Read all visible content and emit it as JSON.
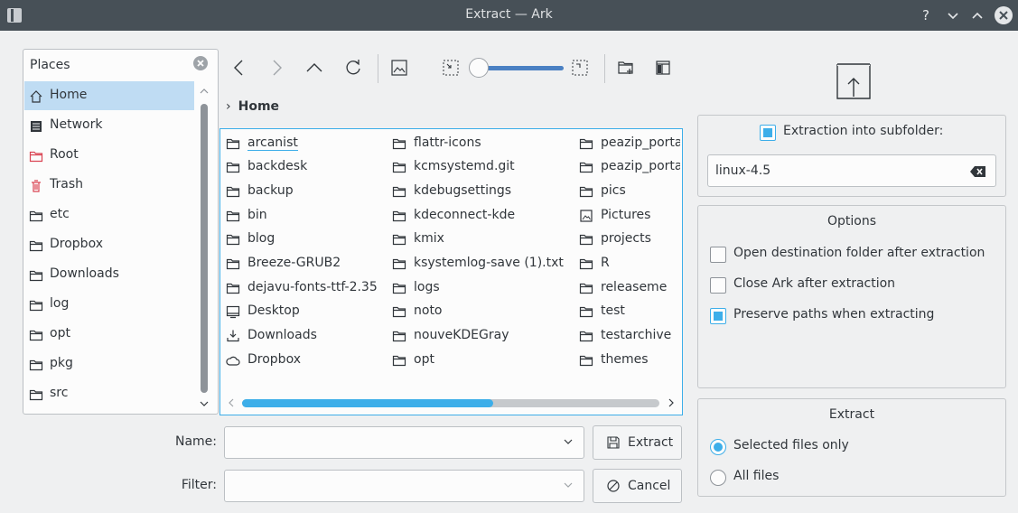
{
  "window": {
    "title": "Extract — Ark"
  },
  "titlebar": {
    "help": "?",
    "minimize": "⌄",
    "maximize": "⌃"
  },
  "places": {
    "header": "Places",
    "items": [
      {
        "label": "Home",
        "icon": "home-icon",
        "selected": true
      },
      {
        "label": "Network",
        "icon": "network-icon"
      },
      {
        "label": "Root",
        "icon": "folder-red-icon"
      },
      {
        "label": "Trash",
        "icon": "trash-icon"
      },
      {
        "label": "etc",
        "icon": "folder-icon"
      },
      {
        "label": "Dropbox",
        "icon": "folder-icon"
      },
      {
        "label": "Downloads",
        "icon": "folder-icon"
      },
      {
        "label": "log",
        "icon": "folder-icon"
      },
      {
        "label": "opt",
        "icon": "folder-icon"
      },
      {
        "label": "pkg",
        "icon": "folder-icon"
      },
      {
        "label": "src",
        "icon": "folder-icon"
      }
    ]
  },
  "breadcrumb": {
    "current": "Home"
  },
  "files": {
    "columns": [
      [
        "arcanist",
        "backdesk",
        "backup",
        "bin",
        "blog",
        "Breeze-GRUB2",
        "dejavu-fonts-ttf-2.35",
        "Desktop",
        "Downloads",
        "Dropbox"
      ],
      [
        "flattr-icons",
        "kcmsystemd.git",
        "kdebugsettings",
        "kdeconnect-kde",
        "kmix",
        "ksystemlog-save (1).txt",
        "logs",
        "noto",
        "nouveKDEGray",
        "opt"
      ],
      [
        "peazip_portable",
        "peazip_portable",
        "pics",
        "Pictures",
        "projects",
        "R",
        "releaseme",
        "test",
        "testarchive",
        "themes"
      ]
    ]
  },
  "form": {
    "name_label": "Name:",
    "name_value": "",
    "filter_label": "Filter:",
    "filter_value": "",
    "extract_button": "Extract",
    "cancel_button": "Cancel"
  },
  "subfolder": {
    "label": "Extraction into subfolder:",
    "checked": true,
    "value": "linux-4.5"
  },
  "options": {
    "title": "Options",
    "items": [
      {
        "label": "Open destination folder after extraction",
        "checked": false
      },
      {
        "label": "Close Ark after extraction",
        "checked": false
      },
      {
        "label": "Preserve paths when extracting",
        "checked": true
      }
    ]
  },
  "extract_group": {
    "title": "Extract",
    "options": [
      {
        "label": "Selected files only",
        "checked": true
      },
      {
        "label": "All files",
        "checked": false
      }
    ]
  },
  "colors": {
    "accent": "#3daee9",
    "titlebar": "#475057",
    "selection": "#bfdcf3"
  }
}
